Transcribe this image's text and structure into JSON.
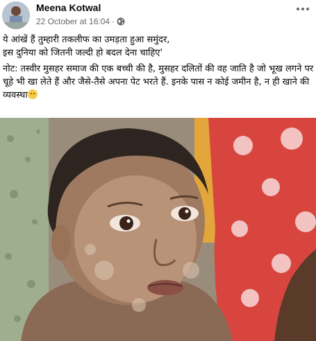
{
  "post": {
    "author": "Meena Kotwal",
    "timestamp": "22 October at 16:04",
    "separator": "·",
    "text_line1": "ये आंखें हैं तुम्हारी तकलीफ का उमड़ता हुआ समुंदर,",
    "text_line2": "इस दुनिया को जितनी जल्दी हो बदल देना चाहिए'",
    "note": "नोट: तस्वीर मुसहर समाज की एक बच्ची की है, मुसहर दलितों की वह जाति है जो भूख लगने पर चूहे भी खा लेते हैं और जैसे-तैसे अपना पेट भरते हैं. इनके पास न कोई जमीन है, न ही खाने की व्यवस्था",
    "note_emoji": "crying-face-emoji"
  },
  "icons": {
    "audience": "globe-icon",
    "more": "more-options-icon"
  },
  "colors": {
    "text": "#050505",
    "secondary": "#65676b"
  }
}
